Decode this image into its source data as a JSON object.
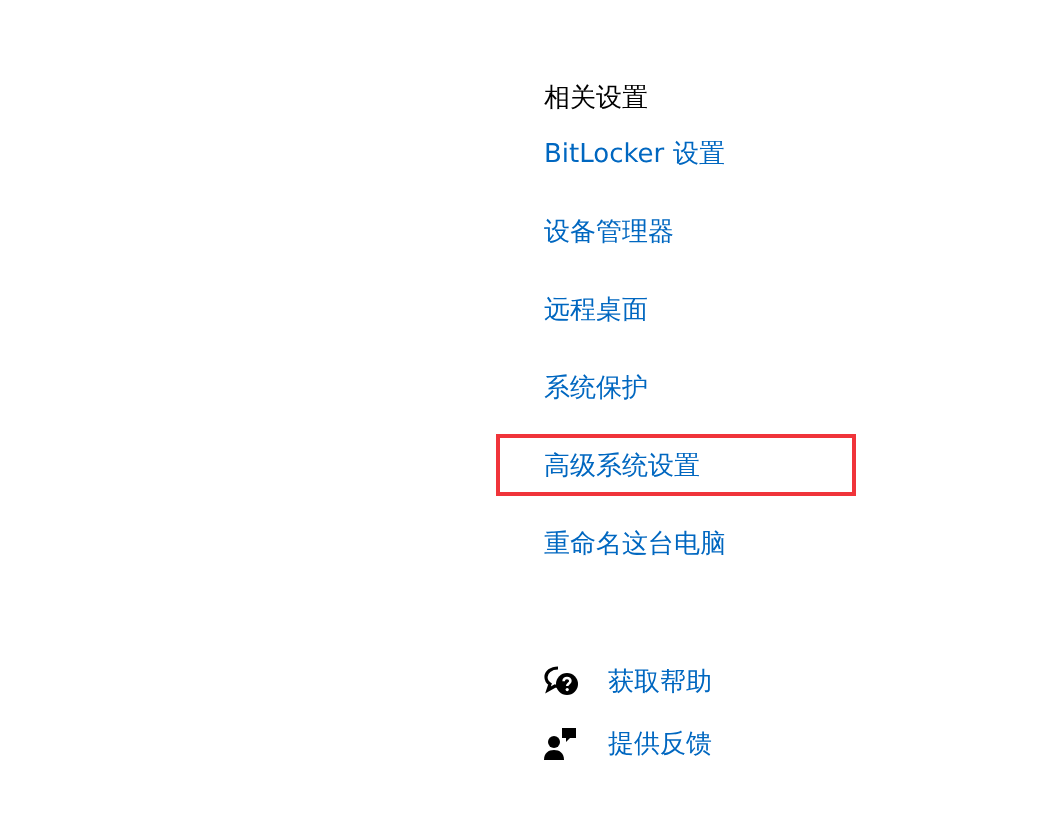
{
  "related_settings": {
    "heading": "相关设置",
    "links": [
      {
        "label": "BitLocker 设置",
        "highlighted": false
      },
      {
        "label": "设备管理器",
        "highlighted": false
      },
      {
        "label": "远程桌面",
        "highlighted": false
      },
      {
        "label": "系统保护",
        "highlighted": false
      },
      {
        "label": "高级系统设置",
        "highlighted": true
      },
      {
        "label": "重命名这台电脑",
        "highlighted": false
      }
    ]
  },
  "support": [
    {
      "kind": "help",
      "label": "获取帮助"
    },
    {
      "kind": "feedback",
      "label": "提供反馈"
    }
  ]
}
